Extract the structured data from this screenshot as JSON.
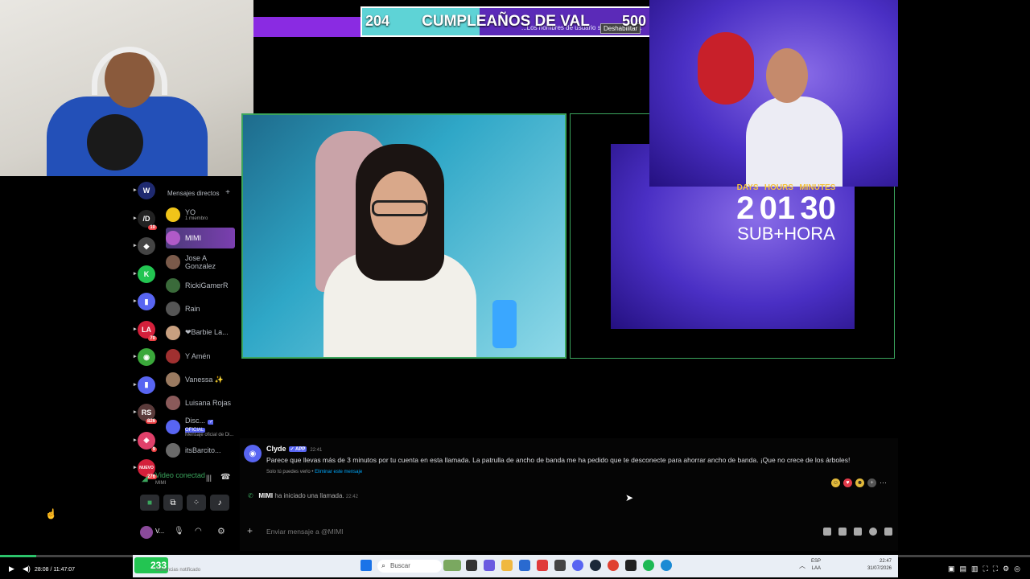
{
  "goal": {
    "current": "204",
    "title": "CUMPLEAÑOS DE VAL",
    "target": "500",
    "progress_fraction": 0.408,
    "overlay_message": "...Los nombres de usuario se ha truncado.",
    "overlay_button": "Deshabilitar",
    "dm_header_ghost": "Mensajes directos"
  },
  "timer": {
    "labels": [
      "DAYS",
      "HOURS",
      "MINUTES"
    ],
    "values": [
      "2",
      "01",
      "30"
    ],
    "subtitle": "SUB+HORA"
  },
  "servers": [
    {
      "label": "W",
      "color": "#1f2a70",
      "badge": ""
    },
    {
      "label": "/D",
      "color": "#222",
      "badge": "10"
    },
    {
      "label": "◆",
      "color": "#444",
      "badge": ""
    },
    {
      "label": "K",
      "color": "#23c552",
      "badge": ""
    },
    {
      "label": "▮",
      "color": "#5865f2",
      "badge": ""
    },
    {
      "label": "LA",
      "color": "#d4203b",
      "badge": "70"
    },
    {
      "label": "◉",
      "color": "#3aa83a",
      "badge": ""
    },
    {
      "label": "▮",
      "color": "#5865f2",
      "badge": ""
    },
    {
      "label": "RS",
      "color": "#5a3a3a",
      "badge": "826"
    },
    {
      "label": "◈",
      "color": "#e0406a",
      "badge": "9"
    },
    {
      "label": "NUEVO",
      "color": "#d4203b",
      "badge": "276"
    }
  ],
  "dm": {
    "header": "Mensajes directos",
    "items": [
      {
        "name": "YO",
        "sub": "1 miembro",
        "color": "#f0c419",
        "active": false
      },
      {
        "name": "MIMI",
        "sub": "",
        "color": "#b05ac8",
        "active": true
      },
      {
        "name": "Jose A Gonzalez",
        "sub": "",
        "color": "#7a5a4a",
        "active": false
      },
      {
        "name": "RickiGamerR",
        "sub": "",
        "color": "#3a6a3a",
        "active": false
      },
      {
        "name": "Rain",
        "sub": "",
        "color": "#555",
        "active": false
      },
      {
        "name": "❤Barbie La...",
        "sub": "",
        "color": "#c8a080",
        "active": false
      },
      {
        "name": "Y Amén",
        "sub": "",
        "color": "#a03030",
        "active": false
      },
      {
        "name": "Vanessa ✨",
        "sub": "",
        "color": "#9a7a60",
        "active": false
      },
      {
        "name": "Luisana Rojas",
        "sub": "",
        "color": "#8a5a5a",
        "active": false
      },
      {
        "name": "Disc...",
        "sub": "Mensaje oficial de Di...",
        "color": "#5865f2",
        "active": false
      },
      {
        "name": "itsBarcito...",
        "sub": "",
        "color": "#6a6a6a",
        "active": false
      }
    ],
    "official_tag": "✓ OFICIAL"
  },
  "voice": {
    "status": "Video conectad",
    "channel": "MIMI"
  },
  "user": {
    "name": "V..."
  },
  "chat": {
    "author": "Clyde",
    "app_tag": "✓ APP",
    "time": "22:41",
    "text": "Parece que llevas más de 3 minutos por tu cuenta en esta llamada. La patrulla de ancho de banda me ha pedido que te desconecte para ahorrar ancho de banda. ¡Que no crece de los árboles!",
    "note": "Solo tú puedes verlo •",
    "note_link": "Eliminar este mensaje",
    "call_user": "MIMI",
    "call_text": "ha iniciado una llamada.",
    "call_time": "22:42",
    "input_placeholder": "Enviar mensaje a @MIMI"
  },
  "player": {
    "time": "28:08 / 11:47:07",
    "progress_fraction": 0.035
  },
  "taskbar": {
    "search": "Buscar",
    "game_score": "233",
    "game_label": "Ganancias notificado",
    "lang": "ESP",
    "lang2": "LAA",
    "clock": "22:47",
    "date": "31/07/2026"
  },
  "colors": {
    "discord_green": "#3ba55d",
    "blurple": "#5865f2",
    "goal_cyan": "#5ed3d6",
    "goal_purple": "#8a2be2"
  }
}
